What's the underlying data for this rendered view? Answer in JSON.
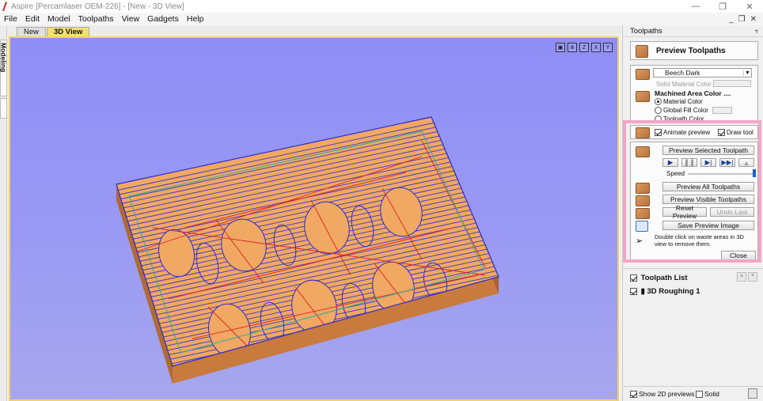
{
  "window": {
    "title": "Aspire [Percamlaser OEM-226] - [New - 3D View]",
    "controls": [
      "—",
      "❐",
      "✕"
    ]
  },
  "menu": [
    "File",
    "Edit",
    "Model",
    "Toolpaths",
    "View",
    "Gadgets",
    "Help"
  ],
  "mdi_controls": [
    "_",
    "❐",
    "✕"
  ],
  "left_tab": "Modeling",
  "tabs": [
    "New",
    "3D View"
  ],
  "view_icons": [
    "fit",
    "iso",
    "Z",
    "X",
    "Y"
  ],
  "panel": {
    "title": "Toolpaths",
    "pin": "▿",
    "preview_title": "Preview Toolpaths",
    "material": "Beech Dark",
    "solid_material_color": "Solid Material Color",
    "machined_area_color": "Machined Area Color ....",
    "radio_material": "Material Color",
    "radio_global": "Global Fill Color",
    "radio_toolpath": "Toolpath Color",
    "animate_preview": "Animate preview",
    "draw_tool": "Draw tool",
    "preview_selected": "Preview Selected Toolpath",
    "speed": "Speed",
    "preview_all": "Preview All Toolpaths",
    "preview_visible": "Preview Visible Toolpaths",
    "reset_preview": "Reset Preview",
    "undo_last": "Undo Last",
    "save_preview": "Save Preview Image",
    "hint": "Double click on waste areas in 3D view to remove them.",
    "close": "Close",
    "toolpath_list": "Toolpath List",
    "toolpath_item": "3D Roughing 1",
    "show_2d": "Show 2D previews",
    "solid": "Solid"
  },
  "colors": {
    "accent": "#f3df74",
    "viewport": "#9a9af4",
    "highlight": "#f2a6c6",
    "toolpath": "#2a2ad0",
    "wood": "#f0a862"
  }
}
